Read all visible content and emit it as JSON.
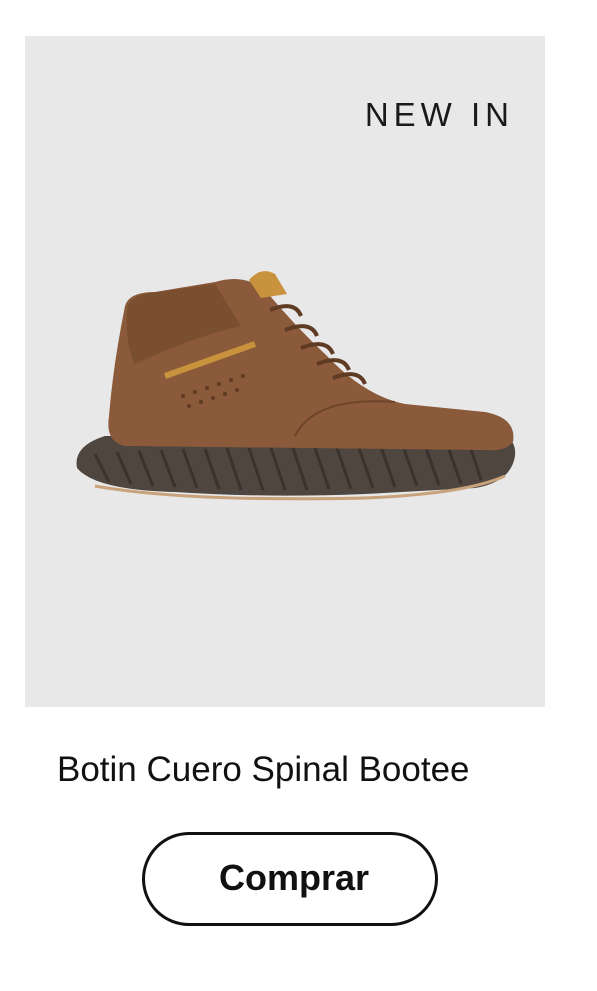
{
  "product": {
    "badge": "NEW IN",
    "name": "Botin Cuero Spinal Bootee",
    "image_icon": "boot-image",
    "cta_label": "Comprar"
  },
  "colors": {
    "image_background": "#e8e8e8",
    "leather": "#8a5a3a",
    "sole": "#4f4640",
    "accent": "#c9933d",
    "button_border": "#111111"
  }
}
